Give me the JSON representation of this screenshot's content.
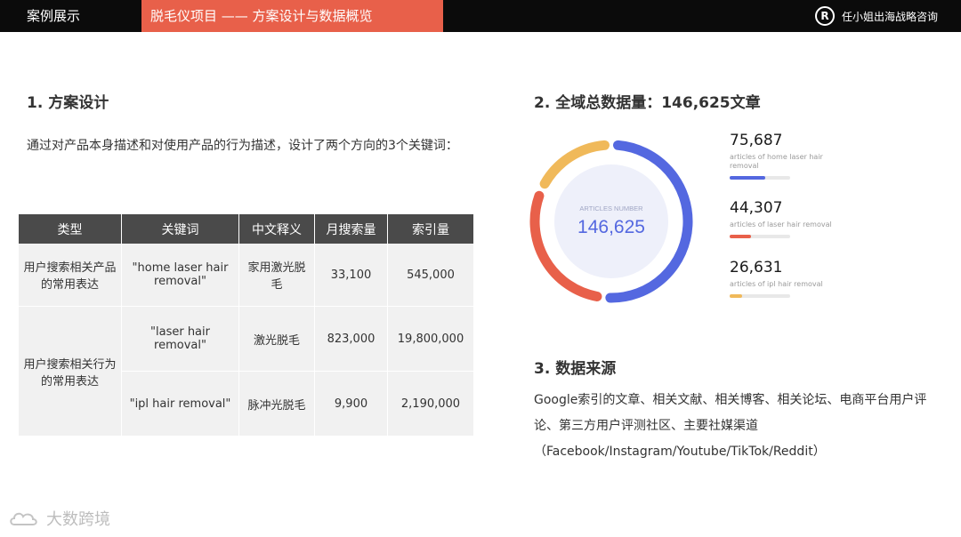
{
  "header": {
    "section": "案例展示",
    "project": "脱毛仪项目 —— 方案设计与数据概览",
    "brand": "任小姐出海战略咨询",
    "brand_logo_icon": "R-circle-logo"
  },
  "plan": {
    "title": "1. 方案设计",
    "description": "通过对产品本身描述和对使用产品的行为描述，设计了两个方向的3个关键词：",
    "table": {
      "headers": [
        "类型",
        "关键词",
        "中文释义",
        "月搜索量",
        "索引量"
      ],
      "groups": [
        {
          "type": "用户搜索相关产品的常用表达",
          "rows": [
            {
              "keyword": "\"home laser hair removal\"",
              "meaning": "家用激光脱毛",
              "monthly": "33,100",
              "index": "545,000"
            }
          ]
        },
        {
          "type": "用户搜索相关行为的常用表达",
          "rows": [
            {
              "keyword": "\"laser hair removal\"",
              "meaning": "激光脱毛",
              "monthly": "823,000",
              "index": "19,800,000"
            },
            {
              "keyword": "\"ipl hair removal\"",
              "meaning": "脉冲光脱毛",
              "monthly": "9,900",
              "index": "2,190,000"
            }
          ]
        }
      ]
    }
  },
  "totals": {
    "title": "2. 全域总数据量：146,625文章",
    "center_label": "ARTICLES NUMBER",
    "center_value": "146,625",
    "items": [
      {
        "value": "75,687",
        "label": "articles of home laser hair removal",
        "color": "#5468e0",
        "fraction": 0.516
      },
      {
        "value": "44,307",
        "label": "articles of laser hair removal",
        "color": "#e8604a",
        "fraction": 0.302
      },
      {
        "value": "26,631",
        "label": "articles of ipl hair removal",
        "color": "#f0b95a",
        "fraction": 0.182
      }
    ]
  },
  "source": {
    "title": "3. 数据来源",
    "text": "Google索引的文章、相关文献、相关博客、相关论坛、电商平台用户评论、第三方用户评测社区、主要社媒渠道（Facebook/Instagram/Youtube/TikTok/Reddit）"
  },
  "watermark": {
    "text": "大数跨境",
    "icon": "cloud-logo-icon"
  }
}
